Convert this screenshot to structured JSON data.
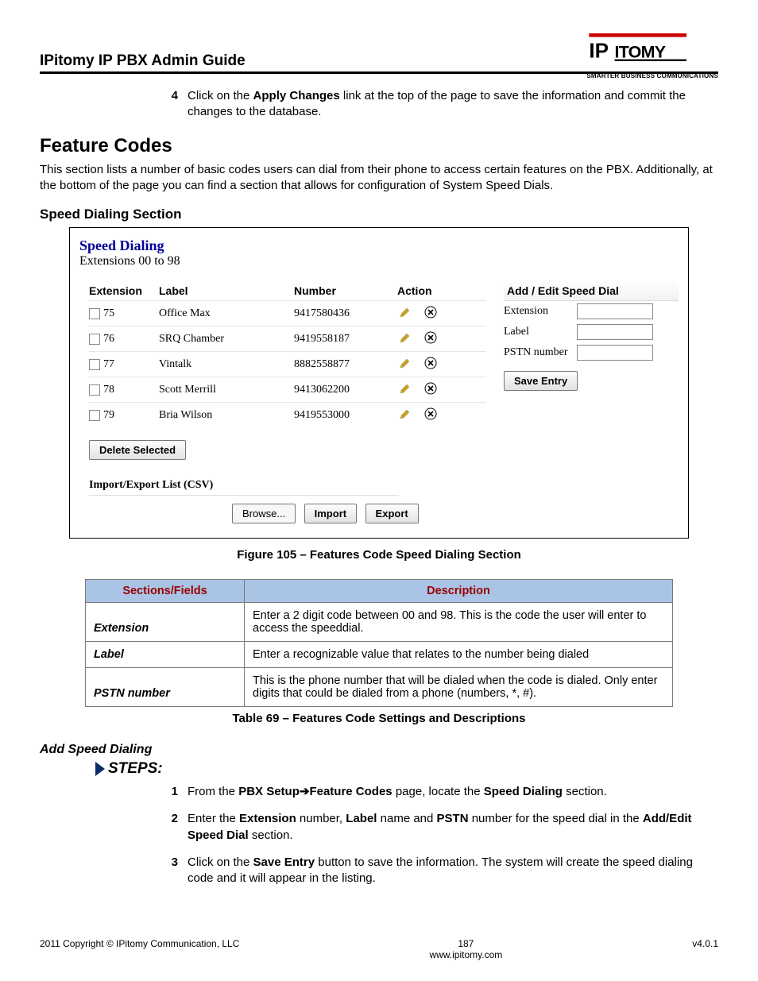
{
  "header": {
    "title": "IPitomy IP PBX Admin Guide",
    "logo_line1": "IP",
    "logo_line2": "ITOMY",
    "logo_tag": "SMARTER BUSINESS COMMUNICATIONS"
  },
  "top_step": {
    "num": "4",
    "prefix": "Click on the ",
    "bold1": "Apply Changes",
    "rest": " link at the top of the page to save the information and commit the changes to the database."
  },
  "sections": {
    "feature_codes_h": "Feature Codes",
    "feature_codes_p": "This section lists a number of basic codes users can dial from their phone to access certain features on the PBX. Additionally, at the bottom of the page you can find a section that allows for configuration of System Speed Dials.",
    "speed_dialing_h": "Speed Dialing Section",
    "add_speed_h": "Add Speed Dialing",
    "steps_h": "STEPS:"
  },
  "shot": {
    "title": "Speed Dialing",
    "subtitle": "Extensions 00 to 98",
    "head_ext": "Extension",
    "head_label": "Label",
    "head_num": "Number",
    "head_action": "Action",
    "rows": [
      {
        "ext": "75",
        "label": "Office Max",
        "number": "9417580436"
      },
      {
        "ext": "76",
        "label": "SRQ Chamber",
        "number": "9419558187"
      },
      {
        "ext": "77",
        "label": "Vintalk",
        "number": "8882558877"
      },
      {
        "ext": "78",
        "label": "Scott Merrill",
        "number": "9413062200"
      },
      {
        "ext": "79",
        "label": "Bria Wilson",
        "number": "9419553000"
      }
    ],
    "delete_btn": "Delete Selected",
    "import_head": "Import/Export List (CSV)",
    "browse_btn": "Browse...",
    "import_btn": "Import",
    "export_btn": "Export",
    "addedit_head": "Add / Edit Speed Dial",
    "form_ext": "Extension",
    "form_label": "Label",
    "form_pstn": "PSTN number",
    "save_btn": "Save Entry"
  },
  "fig105": "Figure 105 – Features Code Speed Dialing Section",
  "desc_table": {
    "head_left": "Sections/Fields",
    "head_right": "Description",
    "rows": [
      {
        "name": "Extension",
        "desc": "Enter a 2 digit code between 00 and 98.  This is the code the user will enter to access the speeddial."
      },
      {
        "name": "Label",
        "desc": "Enter a recognizable value that relates to the number being dialed"
      },
      {
        "name": "PSTN number",
        "desc": "This is the phone number that will be dialed when the code is dialed. Only enter digits that could be dialed from a phone (numbers, *, #)."
      }
    ],
    "caption": "Table 69 – Features Code Settings and Descriptions"
  },
  "steps": [
    {
      "num": "1",
      "segments": [
        "From the ",
        "PBX Setup",
        "→",
        "Feature Codes",
        " page, locate the ",
        "Speed Dialing",
        " section."
      ]
    },
    {
      "num": "2",
      "segments": [
        "Enter the ",
        "Extension",
        " number, ",
        "Label",
        " name and ",
        "PSTN",
        " number for the speed dial in the ",
        "Add/Edit Speed Dial",
        " section."
      ]
    },
    {
      "num": "3",
      "segments": [
        "Click on the ",
        "Save Entry",
        " button to save the information. The system will create the speed dialing code and it will appear in the listing."
      ]
    }
  ],
  "footer": {
    "left": "2011 Copyright © IPitomy Communication, LLC",
    "page": "187",
    "url": "www.ipitomy.com",
    "right": "v4.0.1"
  }
}
